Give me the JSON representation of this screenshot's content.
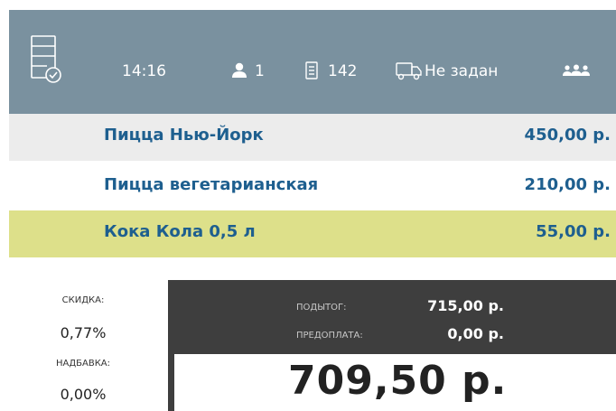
{
  "header": {
    "time": "14:16",
    "guests": "1",
    "order_number": "142",
    "delivery_status": "Не задан",
    "icons": {
      "order": "order-check-icon",
      "guest": "person-icon",
      "order_number": "receipt-icon",
      "delivery": "truck-icon",
      "group": "group-icon"
    }
  },
  "items": [
    {
      "name": "Пицца Нью-Йорк",
      "price": "450,00 р."
    },
    {
      "name": "Пицца вегетарианская",
      "price": "210,00 р."
    },
    {
      "name": "Кока Кола 0,5 л",
      "price": "55,00 р."
    }
  ],
  "summary": {
    "discount_label": "СКИДКА:",
    "discount_value": "0,77%",
    "surcharge_label": "НАДБАВКА:",
    "surcharge_value": "0,00%",
    "subtotal_label": "ПОДЫТОГ:",
    "subtotal_value": "715,00 р.",
    "prepayment_label": "ПРЕДОПЛАТА:",
    "prepayment_value": "0,00 р.",
    "total": "709,50 р."
  },
  "colors": {
    "header_bg": "#7a919f",
    "item_text": "#1e5f8f",
    "row_alt_bg": "#ececec",
    "selected_bg": "#dde08a",
    "footer_dark": "#3e3e3e"
  }
}
